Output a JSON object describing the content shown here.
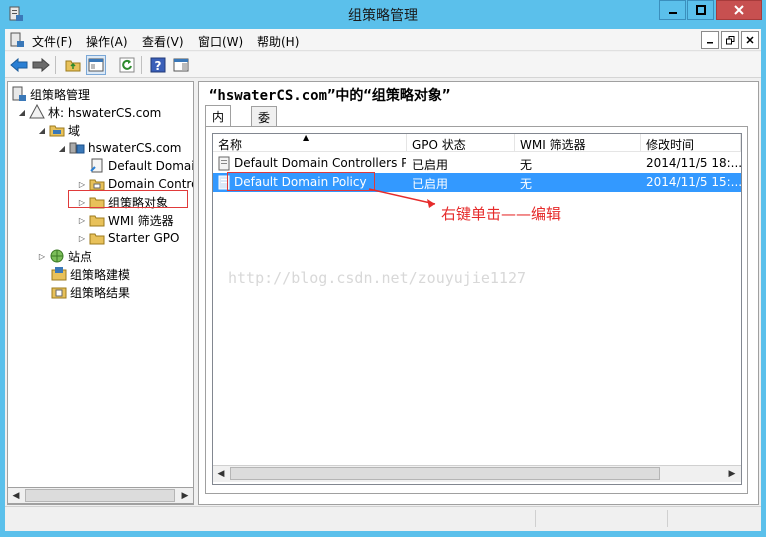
{
  "window": {
    "title": "组策略管理",
    "minimize_label": "—",
    "maximize_label": "☐",
    "close_label": "✕"
  },
  "menu": {
    "items": [
      "文件(F)",
      "操作(A)",
      "查看(V)",
      "窗口(W)",
      "帮助(H)"
    ]
  },
  "tree": {
    "items": [
      {
        "label": "组策略管理",
        "icon": "gpm-root-icon"
      },
      {
        "label": "林: hswaterCS.com",
        "icon": "forest-icon"
      },
      {
        "label": "域",
        "icon": "domains-folder-icon"
      },
      {
        "label": "hswaterCS.com",
        "icon": "domain-icon"
      },
      {
        "label": "Default Domain Policy",
        "icon": "gpo-link-icon"
      },
      {
        "label": "Domain Controllers",
        "icon": "ou-icon"
      },
      {
        "label": "组策略对象",
        "icon": "folder-icon"
      },
      {
        "label": "WMI 筛选器",
        "icon": "folder-icon"
      },
      {
        "label": "Starter GPO",
        "icon": "folder-icon"
      },
      {
        "label": "站点",
        "icon": "sites-icon"
      },
      {
        "label": "组策略建模",
        "icon": "modeling-icon"
      },
      {
        "label": "组策略结果",
        "icon": "results-icon"
      }
    ]
  },
  "right": {
    "header": "“hswaterCS.com”中的“组策略对象”",
    "tabs": [
      "内容",
      "委派"
    ],
    "columns": [
      "名称",
      "GPO 状态",
      "WMI 筛选器",
      "修改时间"
    ],
    "rows": [
      {
        "name": "Default Domain Controllers Policy",
        "status": "已启用",
        "wmi": "无",
        "modified": "2014/11/5 18:..."
      },
      {
        "name": "Default Domain Policy",
        "status": "已启用",
        "wmi": "无",
        "modified": "2014/11/5 15:..."
      }
    ]
  },
  "annotation": {
    "text": "右键单击——编辑",
    "color": "#e62b2b"
  },
  "watermark": "http://blog.csdn.net/zouyujie1127",
  "colors": {
    "titlebar": "#5bc0eb",
    "selection": "#3399ff",
    "highlight": "#e03a3a"
  }
}
